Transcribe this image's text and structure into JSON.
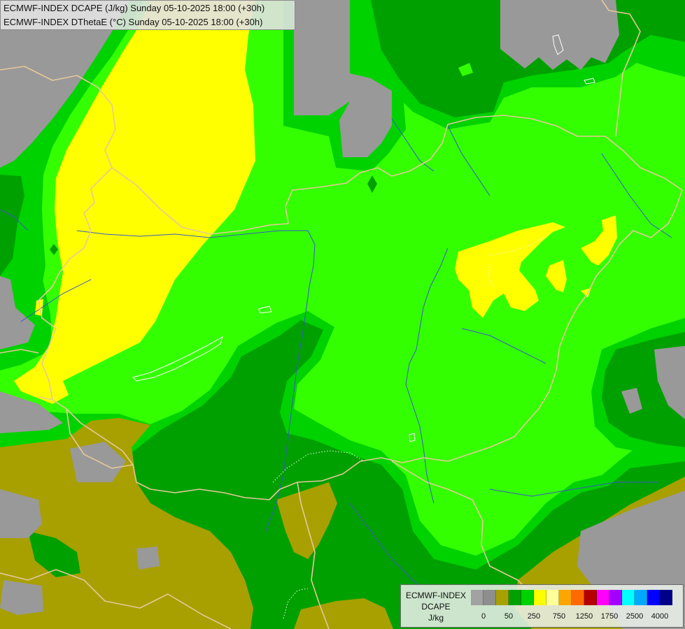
{
  "header": {
    "line1": "ECMWF-INDEX DCAPE (J/kg) Sunday 05-10-2025 18:00 (+30h)",
    "line2": "ECMWF-INDEX DThetaE (°C) Sunday 05-10-2025 18:00 (+30h)"
  },
  "legend": {
    "line1": "ECMWF-INDEX",
    "line2": "DCAPE",
    "unit": "J/kg",
    "labels": [
      "0",
      "50",
      "250",
      "750",
      "1250",
      "1750",
      "2500",
      "4000"
    ],
    "swatches": [
      "#a2a2a2",
      "#8e8e8e",
      "#a8a000",
      "#00a000",
      "#00d200",
      "#ffff00",
      "#ffff99",
      "#ffa500",
      "#ff6a00",
      "#b40000",
      "#ff00ff",
      "#a400ff",
      "#00ffff",
      "#00a8ff",
      "#0000ff",
      "#000088"
    ]
  },
  "colors": {
    "gray": "#999999",
    "olive": "#a8a000",
    "dark_green": "#00a000",
    "green": "#00d200",
    "lime": "#33ff00",
    "yellow": "#ffff00",
    "border": "#e6c89a",
    "river": "#3a58c8",
    "lake": "#ffffff",
    "contour": "#e8ffe0"
  }
}
